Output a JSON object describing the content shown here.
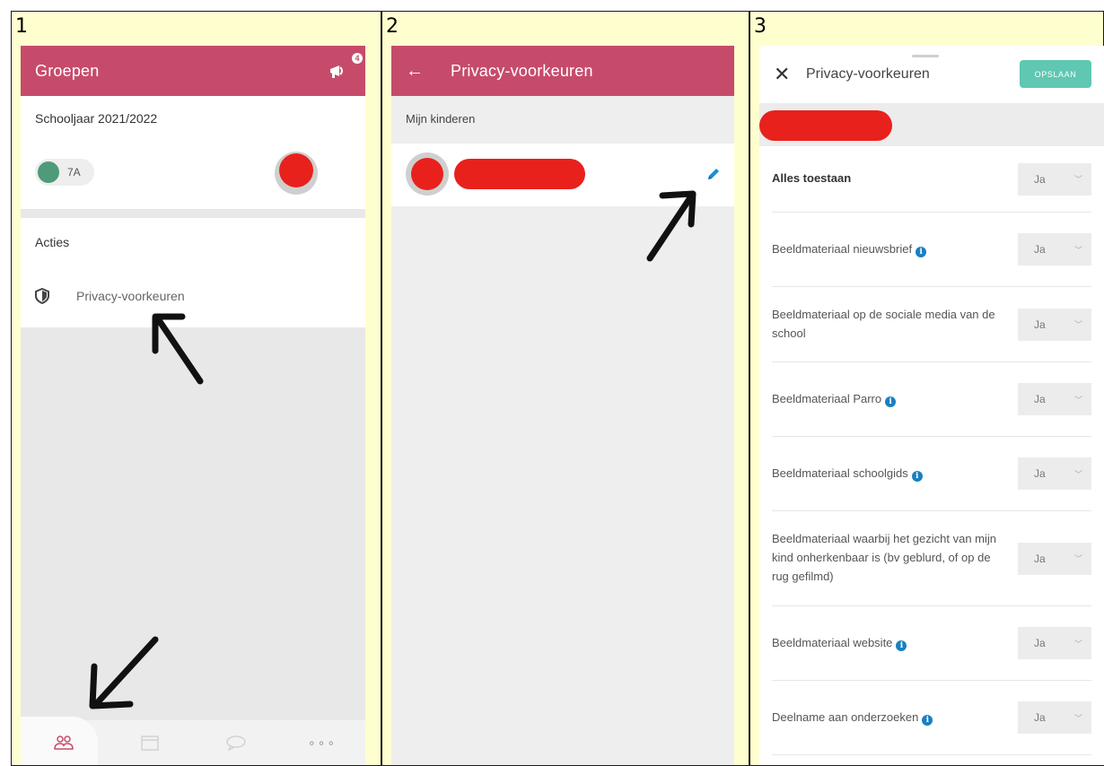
{
  "cells": [
    {
      "number": "1"
    },
    {
      "number": "2"
    },
    {
      "number": "3"
    }
  ],
  "panel1": {
    "header_title": "Groepen",
    "notification_count": "4",
    "school_year": "Schooljaar 2021/2022",
    "group_chip": "7A",
    "actions_heading": "Acties",
    "privacy_item": "Privacy-voorkeuren",
    "nav_icons": [
      "groups-icon",
      "calendar-icon",
      "chat-icon",
      "more-icon"
    ],
    "nav_more": "∘∘∘"
  },
  "panel2": {
    "header_title": "Privacy-voorkeuren",
    "section_heading": "Mijn kinderen"
  },
  "panel3": {
    "title": "Privacy-voorkeuren",
    "save_label": "OPSLAAN",
    "preferences": [
      {
        "label": "Alles toestaan",
        "value": "Ja"
      },
      {
        "label": "Beeldmateriaal nieuwsbrief",
        "value": "Ja"
      },
      {
        "label": "Beeldmateriaal op de sociale media van de school",
        "value": "Ja"
      },
      {
        "label": "Beeldmateriaal Parro",
        "value": "Ja"
      },
      {
        "label": "Beeldmateriaal schoolgids",
        "value": "Ja"
      },
      {
        "label": "Beeldmateriaal waarbij het gezicht van mijn kind onherkenbaar is (bv geblurd, of op de rug gefilmd)",
        "value": "Ja"
      },
      {
        "label": "Beeldmateriaal website",
        "value": "Ja"
      },
      {
        "label": "Deelname aan onderzoeken",
        "value": "Ja"
      }
    ]
  },
  "colors": {
    "header": "#c64b6b",
    "accent_save": "#5fc7b2",
    "redaction": "#e8211d",
    "cell_background": "#fffecf",
    "info_icon": "#1a7fc1"
  }
}
